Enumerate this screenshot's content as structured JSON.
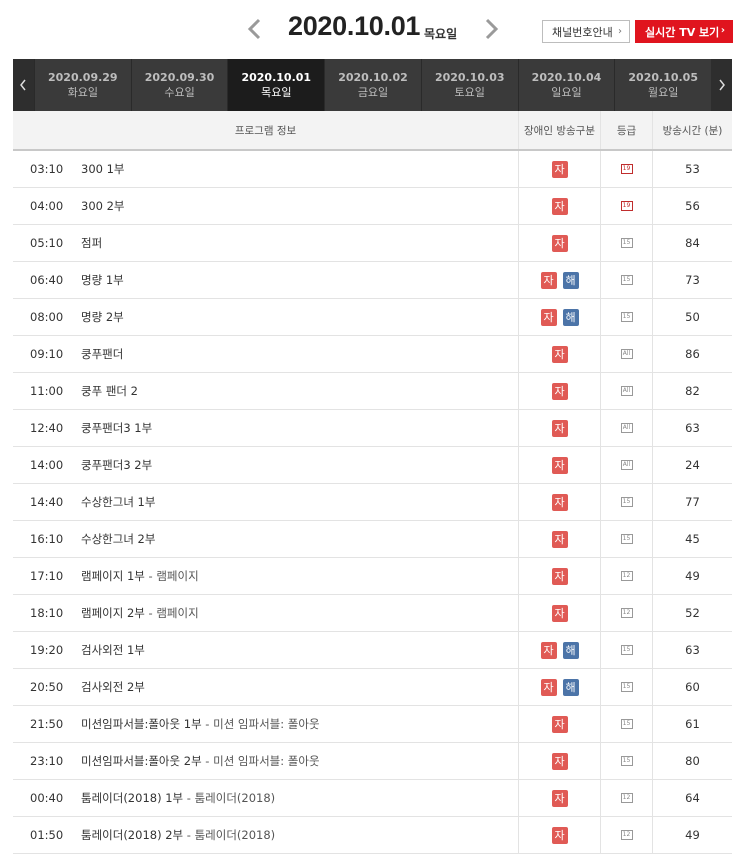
{
  "header": {
    "date": "2020.10.01",
    "weekday": "목요일",
    "channel_button": "채널번호안내",
    "live_button": "실시간 TV 보기"
  },
  "tabs": [
    {
      "date": "2020.09.29",
      "weekday": "화요일"
    },
    {
      "date": "2020.09.30",
      "weekday": "수요일"
    },
    {
      "date": "2020.10.01",
      "weekday": "목요일"
    },
    {
      "date": "2020.10.02",
      "weekday": "금요일"
    },
    {
      "date": "2020.10.03",
      "weekday": "토요일"
    },
    {
      "date": "2020.10.04",
      "weekday": "일요일"
    },
    {
      "date": "2020.10.05",
      "weekday": "월요일"
    }
  ],
  "table": {
    "headers": {
      "info": "프로그램 정보",
      "broadcast": "장애인 방송구분",
      "grade": "등급",
      "duration": "방송시간 (분)"
    },
    "rows": [
      {
        "time": "03:10",
        "title": "300 1부",
        "sub": "",
        "ja": "자",
        "hae": "",
        "grade": "19",
        "duration": "53"
      },
      {
        "time": "04:00",
        "title": "300 2부",
        "sub": "",
        "ja": "자",
        "hae": "",
        "grade": "19",
        "duration": "56"
      },
      {
        "time": "05:10",
        "title": "점퍼",
        "sub": "",
        "ja": "자",
        "hae": "",
        "grade": "15",
        "duration": "84"
      },
      {
        "time": "06:40",
        "title": "명량 1부",
        "sub": "",
        "ja": "자",
        "hae": "해",
        "grade": "15",
        "duration": "73"
      },
      {
        "time": "08:00",
        "title": "명량 2부",
        "sub": "",
        "ja": "자",
        "hae": "해",
        "grade": "15",
        "duration": "50"
      },
      {
        "time": "09:10",
        "title": "쿵푸팬더",
        "sub": "",
        "ja": "자",
        "hae": "",
        "grade": "All",
        "duration": "86"
      },
      {
        "time": "11:00",
        "title": "쿵푸 팬더 2",
        "sub": "",
        "ja": "자",
        "hae": "",
        "grade": "All",
        "duration": "82"
      },
      {
        "time": "12:40",
        "title": "쿵푸팬더3 1부",
        "sub": "",
        "ja": "자",
        "hae": "",
        "grade": "All",
        "duration": "63"
      },
      {
        "time": "14:00",
        "title": "쿵푸팬더3 2부",
        "sub": "",
        "ja": "자",
        "hae": "",
        "grade": "All",
        "duration": "24"
      },
      {
        "time": "14:40",
        "title": "수상한그녀 1부",
        "sub": "",
        "ja": "자",
        "hae": "",
        "grade": "15",
        "duration": "77"
      },
      {
        "time": "16:10",
        "title": "수상한그녀 2부",
        "sub": "",
        "ja": "자",
        "hae": "",
        "grade": "15",
        "duration": "45"
      },
      {
        "time": "17:10",
        "title": "램페이지 1부",
        "sub": " - 램페이지",
        "ja": "자",
        "hae": "",
        "grade": "12",
        "duration": "49"
      },
      {
        "time": "18:10",
        "title": "램페이지 2부",
        "sub": " - 램페이지",
        "ja": "자",
        "hae": "",
        "grade": "12",
        "duration": "52"
      },
      {
        "time": "19:20",
        "title": "검사외전 1부",
        "sub": "",
        "ja": "자",
        "hae": "해",
        "grade": "15",
        "duration": "63"
      },
      {
        "time": "20:50",
        "title": "검사외전 2부",
        "sub": "",
        "ja": "자",
        "hae": "해",
        "grade": "15",
        "duration": "60"
      },
      {
        "time": "21:50",
        "title": "미션임파서블:폴아웃 1부",
        "sub": " - 미션 임파서블: 폴아웃",
        "ja": "자",
        "hae": "",
        "grade": "15",
        "duration": "61"
      },
      {
        "time": "23:10",
        "title": "미션임파서블:폴아웃 2부",
        "sub": " - 미션 임파서블: 폴아웃",
        "ja": "자",
        "hae": "",
        "grade": "15",
        "duration": "80"
      },
      {
        "time": "00:40",
        "title": "툼레이더(2018) 1부",
        "sub": " - 툼레이더(2018)",
        "ja": "자",
        "hae": "",
        "grade": "12",
        "duration": "64"
      },
      {
        "time": "01:50",
        "title": "툼레이더(2018) 2부",
        "sub": " - 툼레이더(2018)",
        "ja": "자",
        "hae": "",
        "grade": "12",
        "duration": "49"
      }
    ]
  },
  "colors": {
    "accent": "#e0141e",
    "badge_ja": "#e05a55",
    "badge_hae": "#4c74a8",
    "tabbar": "#3a3a3a"
  }
}
